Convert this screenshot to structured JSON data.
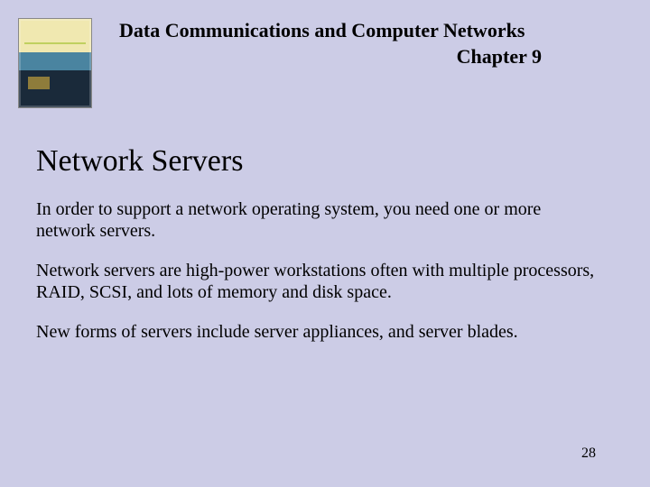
{
  "header": {
    "title_line1": "Data Communications and Computer Networks",
    "title_line2": "Chapter 9"
  },
  "slide": {
    "title": "Network Servers",
    "paragraphs": [
      "In order to support a network operating system, you need one or more network servers.",
      "Network servers are high-power workstations often with multiple processors, RAID, SCSI, and lots of memory and disk space.",
      "New forms of servers include server appliances, and server blades."
    ],
    "page_number": "28"
  }
}
